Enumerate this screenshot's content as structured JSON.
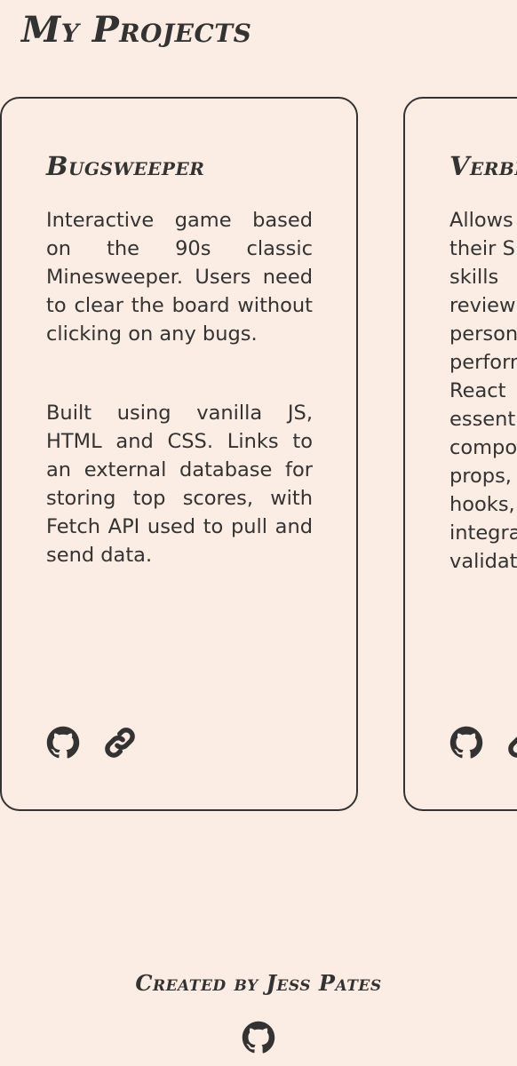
{
  "page": {
    "title": "My Projects"
  },
  "projects": [
    {
      "title": "Bugsweeper",
      "description": "Interactive game based on the 90s classic Minesweeper. Users need to clear the board without clicking on any bugs.",
      "tech": "Built using vanilla JS, HTML and CSS. Links to an external database for storing top scores, with Fetch API used to pull and send data.",
      "links": [
        "github-icon",
        "link-icon"
      ]
    },
    {
      "title": "Verbi",
      "description_lines": [
        "Allows",
        "their S",
        "skills",
        "review",
        "person",
        "perforn",
        "React",
        "essent",
        "compo",
        "props,",
        "hooks,",
        "integra",
        "validat"
      ],
      "links": [
        "github-icon",
        "link-icon"
      ]
    }
  ],
  "footer": {
    "credit": "Created by Jess Pates",
    "icon": "github-icon"
  },
  "colors": {
    "background": "#fcede4",
    "text": "#333333",
    "border": "#333333"
  }
}
